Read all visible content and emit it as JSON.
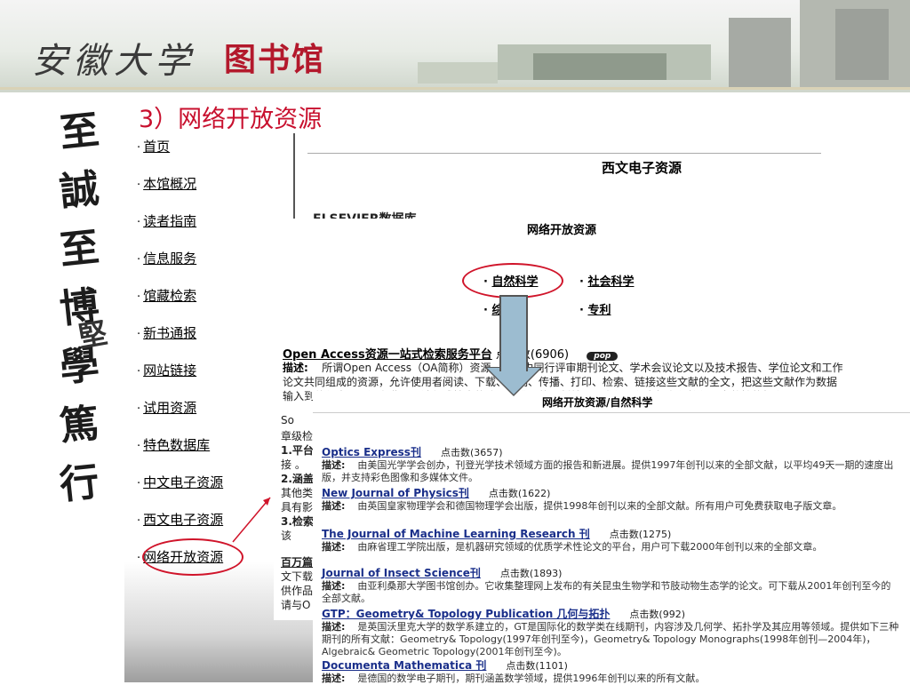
{
  "banner": {
    "calligraphy": "安徽大学",
    "library": "图书馆"
  },
  "motto": [
    "至",
    "誠",
    "至",
    "博",
    "學",
    "篤",
    "行"
  ],
  "motto_small": "堅",
  "slide_heading": "3）网络开放资源",
  "nav": {
    "bullet": "·",
    "items": [
      {
        "label": "首页"
      },
      {
        "label": "本馆概况"
      },
      {
        "label": "读者指南"
      },
      {
        "label": "信息服务"
      },
      {
        "label": "馆藏检索"
      },
      {
        "label": "新书通报"
      },
      {
        "label": "网站链接"
      },
      {
        "label": "试用资源"
      },
      {
        "label": "特色数据库"
      },
      {
        "label": "中文电子资源"
      },
      {
        "label": "西文电子资源"
      },
      {
        "label": "网络开放资源"
      }
    ]
  },
  "panel1": {
    "title": "西文电子资源",
    "subtitle": "ELSEVIER数据库"
  },
  "panel2": {
    "title": "网络开放资源",
    "categories": [
      "自然科学",
      "社会科学",
      "综合",
      "专利"
    ],
    "open_access": {
      "title": "Open Access资源一站式检索服务平台",
      "hits": "点击数(6906)",
      "badge": "pop",
      "desc_label": "描述:",
      "desc": "所谓Open Access（OA简称）资源，是指由同行评审期刊论文、学术会议论文以及技术报告、学位论文和工作论文共同组成的资源，允许使用者阅读、下载、复制、传播、打印、检索、链接这些文献的全文，把这些文献作为数据输入到软件中，而没有费用、法律或技术的障碍，唯一的限制就是要求保证作者拥有保护作品完整性的权利。"
    }
  },
  "left_fragments": [
    "So",
    "章级检",
    "1.平台",
    "接 。",
    "2.涵盖",
    "其他类",
    "具有影",
    "3.检索",
    "  该",
    "百万篇",
    "文下载",
    "供作品",
    "请与O"
  ],
  "panel3": {
    "title": "网络开放资源/自然科学",
    "desc_label": "描述:",
    "journals": [
      {
        "title": "Optics Express刊",
        "hits": "点击数(3657)",
        "desc": "由美国光学学会创办，刊登光学技术领域方面的报告和新进展。提供1997年创刊以来的全部文献，以平均49天一期的速度出版，并支持彩色图像和多媒体文件。"
      },
      {
        "title": "New Journal of Physics刊",
        "hits": "点击数(1622)",
        "desc": "由英国皇家物理学会和德国物理学会出版，提供1998年创刊以来的全部文献。所有用户可免费获取电子版文章。"
      },
      {
        "title": "The Journal of Machine Learning Research 刊",
        "hits": "点击数(1275)",
        "desc": "由麻省理工学院出版，是机器研究领域的优质学术性论文的平台，用户可下载2000年创刊以来的全部文章。"
      },
      {
        "title": "Journal of Insect Science刊",
        "hits": "点击数(1893)",
        "desc": "由亚利桑那大学图书馆创办。它收集整理网上发布的有关昆虫生物学和节肢动物生态学的论文。可下载从2001年创刊至今的全部文献。"
      },
      {
        "title": "GTP：Geometry& Topology Publication 几何与拓扑",
        "hits": "点击数(992)",
        "desc": "是英国沃里克大学的数学系建立的，GT是国际化的数学类在线期刊，内容涉及几何学、拓扑学及其应用等领域。提供如下三种期刊的所有文献：Geometry& Topology(1997年创刊至今)，Geometry& Topology Monographs(1998年创刊—2004年)，Algebraic& Geometric Topology(2001年创刊至今)。"
      },
      {
        "title": "Documenta Mathematica 刊",
        "hits": "点击数(1101)",
        "desc": "是德国的数学电子期刊，期刊涵盖数学领域，提供1996年创刊以来的所有文献。"
      }
    ]
  },
  "colors": {
    "accent_red": "#c8102e",
    "link_blue": "#1a2f8a",
    "arrow_fill": "#9cbcd0"
  }
}
